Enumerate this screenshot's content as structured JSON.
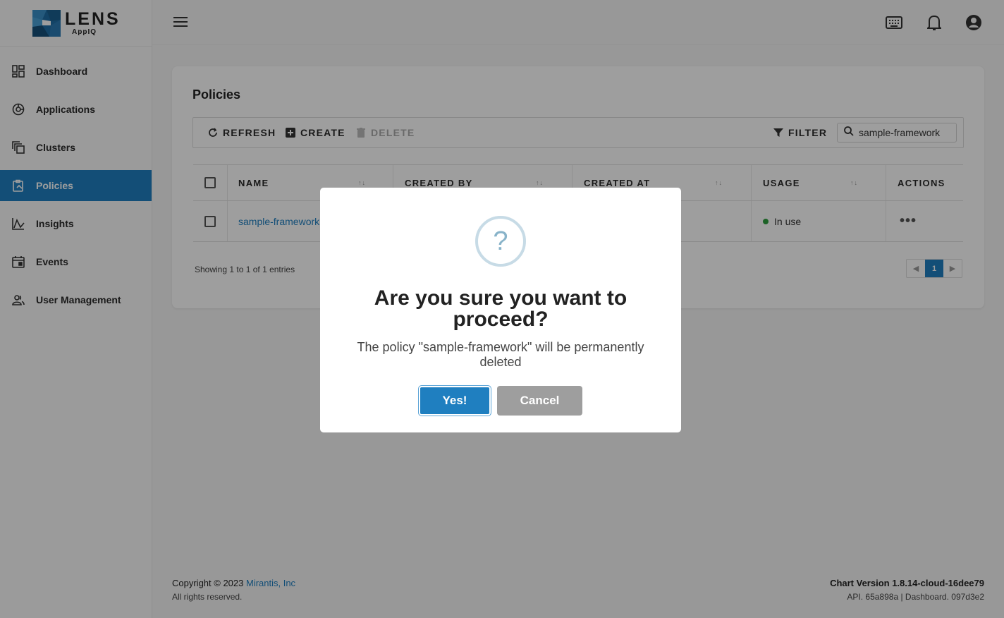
{
  "brand": {
    "name": "LENS",
    "sub": "AppIQ"
  },
  "sidebar": {
    "items": [
      {
        "label": "Dashboard",
        "icon": "dashboard-icon"
      },
      {
        "label": "Applications",
        "icon": "applications-icon"
      },
      {
        "label": "Clusters",
        "icon": "clusters-icon"
      },
      {
        "label": "Policies",
        "icon": "policies-icon",
        "active": true
      },
      {
        "label": "Insights",
        "icon": "insights-icon"
      },
      {
        "label": "Events",
        "icon": "events-icon"
      },
      {
        "label": "User Management",
        "icon": "users-icon"
      }
    ]
  },
  "header": {
    "icons": [
      "menu-icon",
      "keyboard-icon",
      "bell-icon",
      "account-icon"
    ]
  },
  "page": {
    "title": "Policies",
    "toolbar": {
      "refresh": "REFRESH",
      "create": "CREATE",
      "delete": "DELETE",
      "filter": "FILTER"
    },
    "search": {
      "value": "sample-framework"
    },
    "table": {
      "columns": [
        "NAME",
        "CREATED BY",
        "CREATED AT",
        "USAGE",
        "ACTIONS"
      ],
      "rows": [
        {
          "name": "sample-framework",
          "usage": "In use",
          "actions": "•••"
        }
      ]
    },
    "showing": "Showing 1 to 1 of 1 entries",
    "pager": {
      "current": "1"
    }
  },
  "footer": {
    "copyright": "Copyright © 2023",
    "company": "Mirantis, Inc",
    "rights": "All rights reserved.",
    "chart_version": "Chart Version 1.8.14-cloud-16dee79",
    "api": "API. 65a898a | Dashboard. 097d3e2"
  },
  "modal": {
    "icon": "?",
    "title": "Are you sure you want to proceed?",
    "text": "The policy \"sample-framework\" will be permanently deleted",
    "confirm": "Yes!",
    "cancel": "Cancel"
  },
  "colors": {
    "accent": "#1f7fc0",
    "usage_ok": "#2e9e3e",
    "cancel": "#9e9e9e"
  }
}
